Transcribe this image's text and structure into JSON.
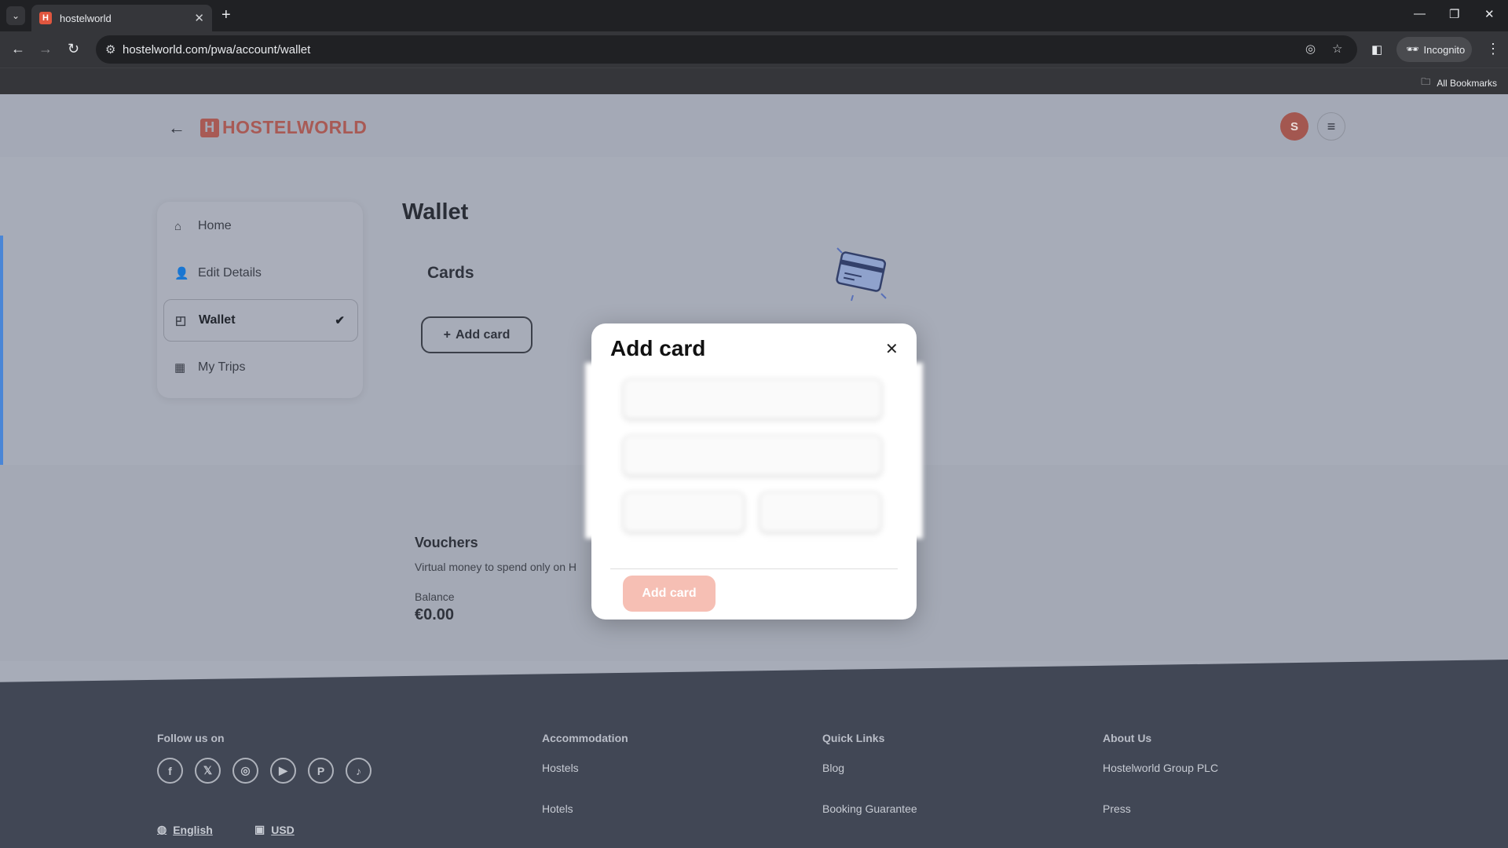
{
  "browser": {
    "tab_title": "hostelworld",
    "favicon_letter": "H",
    "url": "hostelworld.com/pwa/account/wallet",
    "incognito_label": "Incognito",
    "bookmarks_label": "All Bookmarks"
  },
  "header": {
    "logo_text": "HOSTELWORLD",
    "logo_letter": "H",
    "avatar_initial": "S"
  },
  "sidebar": {
    "items": [
      {
        "label": "Home",
        "icon": "home-icon"
      },
      {
        "label": "Edit Details",
        "icon": "user-icon"
      },
      {
        "label": "Wallet",
        "icon": "wallet-icon",
        "active": true
      },
      {
        "label": "My Trips",
        "icon": "map-icon"
      }
    ]
  },
  "main": {
    "title": "Wallet",
    "cards_title": "Cards",
    "add_card_label": "Add card",
    "vouchers_title": "Vouchers",
    "vouchers_subtitle": "Virtual money to spend only on H",
    "balance_label": "Balance",
    "balance_value": "€0.00"
  },
  "modal": {
    "title": "Add card",
    "submit_label": "Add card"
  },
  "footer": {
    "follow_label": "Follow us on",
    "accommodation_heading": "Accommodation",
    "accommodation_links": [
      "Hostels",
      "Hotels"
    ],
    "quick_links_heading": "Quick Links",
    "quick_links": [
      "Blog",
      "Booking Guarantee"
    ],
    "about_heading": "About Us",
    "about_links": [
      "Hostelworld Group PLC",
      "Press"
    ],
    "language": "English",
    "currency": "USD",
    "social": [
      "facebook-icon",
      "x-icon",
      "instagram-icon",
      "youtube-icon",
      "pinterest-icon",
      "tiktok-icon"
    ]
  },
  "colors": {
    "brand": "#a85a55",
    "overlay_page": "#a7acb8",
    "footer_bg": "#414755",
    "submit_disabled": "#f6bfb4"
  }
}
